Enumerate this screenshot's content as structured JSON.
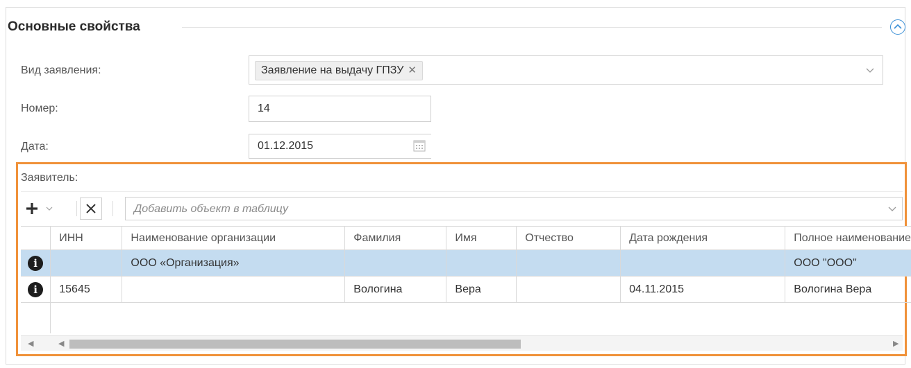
{
  "section": {
    "title": "Основные свойства"
  },
  "form": {
    "type_label": "Вид заявления:",
    "type_value": "Заявление на выдачу ГПЗУ",
    "number_label": "Номер:",
    "number_value": "14",
    "date_label": "Дата:",
    "date_value": "01.12.2015"
  },
  "applicant": {
    "label": "Заявитель:",
    "add_placeholder": "Добавить объект в таблицу",
    "columns": [
      "ИНН",
      "Наименование организации",
      "Фамилия",
      "Имя",
      "Отчество",
      "Дата рождения",
      "Полное наименование"
    ],
    "rows": [
      {
        "inn": "",
        "org": "ООО «Организация»",
        "last": "",
        "first": "",
        "middle": "",
        "birth": "",
        "full": "ООО \"ООО\""
      },
      {
        "inn": "15645",
        "org": "",
        "last": "Вологина",
        "first": "Вера",
        "middle": "",
        "birth": "04.11.2015",
        "full": "Вологина Вера"
      }
    ]
  },
  "colors": {
    "highlight": "#f0923a",
    "selected_row": "#c4dcf0",
    "accent": "#3a8fd6"
  },
  "icons": [
    "chevron-up-circle-icon",
    "remove-tag-icon",
    "chevron-down-icon",
    "calendar-icon",
    "plus-icon",
    "close-icon",
    "info-icon"
  ]
}
